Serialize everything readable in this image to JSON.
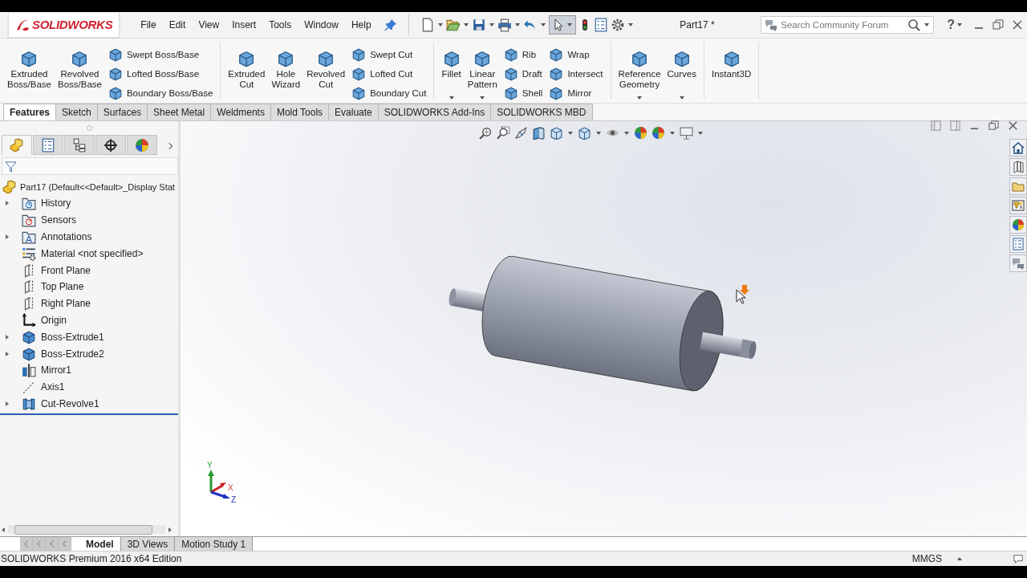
{
  "title_bar": {
    "logo": "SOLIDWORKS",
    "menu": [
      {
        "label": "File"
      },
      {
        "label": "Edit"
      },
      {
        "label": "View"
      },
      {
        "label": "Insert"
      },
      {
        "label": "Tools"
      },
      {
        "label": "Window"
      },
      {
        "label": "Help"
      }
    ],
    "select_tool": {
      "pressed": true
    },
    "document_title": "Part17 *",
    "search": {
      "placeholder": "Search Community Forum"
    },
    "help": "?"
  },
  "ribbon": {
    "groups": [
      {
        "columns": [
          {
            "kind": "large",
            "label": "Extruded Boss/Base",
            "dropdown": false
          },
          {
            "kind": "large",
            "label": "Revolved Boss/Base",
            "dropdown": false
          },
          {
            "kind": "stack",
            "items": [
              "Swept Boss/Base",
              "Lofted Boss/Base",
              "Boundary Boss/Base"
            ]
          }
        ]
      },
      {
        "columns": [
          {
            "kind": "large",
            "label": "Extruded Cut",
            "dropdown": false
          },
          {
            "kind": "large",
            "label": "Hole Wizard",
            "dropdown": false
          },
          {
            "kind": "large",
            "label": "Revolved Cut",
            "dropdown": false
          },
          {
            "kind": "stack",
            "items": [
              "Swept Cut",
              "Lofted Cut",
              "Boundary Cut"
            ]
          }
        ]
      },
      {
        "columns": [
          {
            "kind": "large",
            "label": "Fillet",
            "dropdown": true
          },
          {
            "kind": "large",
            "label": "Linear Pattern",
            "dropdown": true
          },
          {
            "kind": "stack",
            "items": [
              "Rib",
              "Draft",
              "Shell"
            ]
          },
          {
            "kind": "stack",
            "items": [
              "Wrap",
              "Intersect",
              "Mirror"
            ]
          }
        ]
      },
      {
        "columns": [
          {
            "kind": "large",
            "label": "Reference Geometry",
            "dropdown": true
          },
          {
            "kind": "large",
            "label": "Curves",
            "dropdown": true
          }
        ]
      },
      {
        "columns": [
          {
            "kind": "large",
            "label": "Instant3D",
            "dropdown": false
          }
        ]
      }
    ]
  },
  "command_tabs": [
    {
      "label": "Features",
      "selected": true
    },
    {
      "label": "Sketch",
      "selected": false
    },
    {
      "label": "Surfaces",
      "selected": false
    },
    {
      "label": "Sheet Metal",
      "selected": false
    },
    {
      "label": "Weldments",
      "selected": false
    },
    {
      "label": "Mold Tools",
      "selected": false
    },
    {
      "label": "Evaluate",
      "selected": false
    },
    {
      "label": "SOLIDWORKS Add-Ins",
      "selected": false
    },
    {
      "label": "SOLIDWORKS MBD",
      "selected": false
    }
  ],
  "feature_manager": {
    "tabs": [
      {
        "selected": true
      },
      {
        "selected": false
      },
      {
        "selected": false
      },
      {
        "selected": false
      },
      {
        "selected": false
      }
    ],
    "root": "Part17  (Default<<Default>_Display Stat",
    "items": [
      {
        "label": "History",
        "kind": "history",
        "expandable": true
      },
      {
        "label": "Sensors",
        "kind": "sensors",
        "expandable": false
      },
      {
        "label": "Annotations",
        "kind": "annotations",
        "expandable": true
      },
      {
        "label": "Material <not specified>",
        "kind": "material",
        "expandable": false
      },
      {
        "label": "Front Plane",
        "kind": "plane",
        "expandable": false
      },
      {
        "label": "Top Plane",
        "kind": "plane",
        "expandable": false
      },
      {
        "label": "Right Plane",
        "kind": "plane",
        "expandable": false
      },
      {
        "label": "Origin",
        "kind": "origin",
        "expandable": false
      },
      {
        "label": "Boss-Extrude1",
        "kind": "extrude",
        "expandable": true
      },
      {
        "label": "Boss-Extrude2",
        "kind": "extrude",
        "expandable": true
      },
      {
        "label": "Mirror1",
        "kind": "mirror",
        "expandable": false
      },
      {
        "label": "Axis1",
        "kind": "axis",
        "expandable": false
      },
      {
        "label": "Cut-Revolve1",
        "kind": "revolve",
        "expandable": true
      }
    ]
  },
  "viewport": {
    "triad": {
      "x": "X",
      "y": "Y",
      "z": "Z"
    }
  },
  "bottom_tabs": [
    {
      "label": "Model",
      "selected": true
    },
    {
      "label": "3D Views",
      "selected": false
    },
    {
      "label": "Motion Study 1",
      "selected": false
    }
  ],
  "status_bar": {
    "text": "SOLIDWORKS Premium 2016 x64 Edition",
    "units": "MMGS"
  }
}
